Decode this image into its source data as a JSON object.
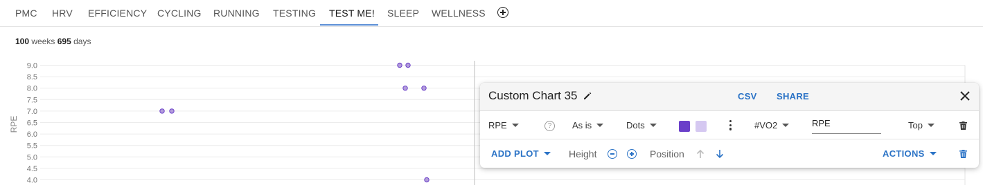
{
  "tabs": [
    {
      "label": "PMC",
      "active": false
    },
    {
      "label": "HRV",
      "active": false
    },
    {
      "label": "EFFICIENCY",
      "active": false
    },
    {
      "label": "CYCLING",
      "active": false
    },
    {
      "label": "RUNNING",
      "active": false
    },
    {
      "label": "TESTING",
      "active": false
    },
    {
      "label": "TEST ME!",
      "active": true
    },
    {
      "label": "SLEEP",
      "active": false
    },
    {
      "label": "WELLNESS",
      "active": false
    }
  ],
  "add_tab_icon": "plus-circle-icon",
  "range": {
    "weeks_value": "100",
    "weeks_unit": "weeks",
    "days_value": "695",
    "days_unit": "days"
  },
  "chart_data": {
    "type": "scatter",
    "ylabel": "RPE",
    "ylim": [
      4.0,
      9.0
    ],
    "yticks": [
      "9.0",
      "8.5",
      "8.0",
      "7.5",
      "7.0",
      "6.5",
      "6.0",
      "5.5",
      "5.0",
      "4.5",
      "4.0"
    ],
    "grid": true,
    "points": [
      {
        "i": 0,
        "y": 7.0
      },
      {
        "i": 1,
        "y": 7.0
      },
      {
        "i": 2,
        "y": 9.0
      },
      {
        "i": 3,
        "y": 9.0
      },
      {
        "i": 4,
        "y": 8.0
      },
      {
        "i": 5,
        "y": 8.0
      },
      {
        "i": 6,
        "y": 4.0
      }
    ],
    "point_color": "#b39ddb",
    "point_stroke": "#6a3fc9"
  },
  "panel": {
    "title": "Custom Chart 35",
    "csv": "CSV",
    "share": "SHARE",
    "plot": {
      "metric": "RPE",
      "transform": "As is",
      "style": "Dots",
      "color_main": "#6a3fc9",
      "color_light": "#d5c8f1",
      "tag": "#VO2",
      "label_value": "RPE",
      "axis_position": "Top"
    },
    "add_plot": "ADD PLOT",
    "height_label": "Height",
    "position_label": "Position",
    "actions": "ACTIONS"
  }
}
